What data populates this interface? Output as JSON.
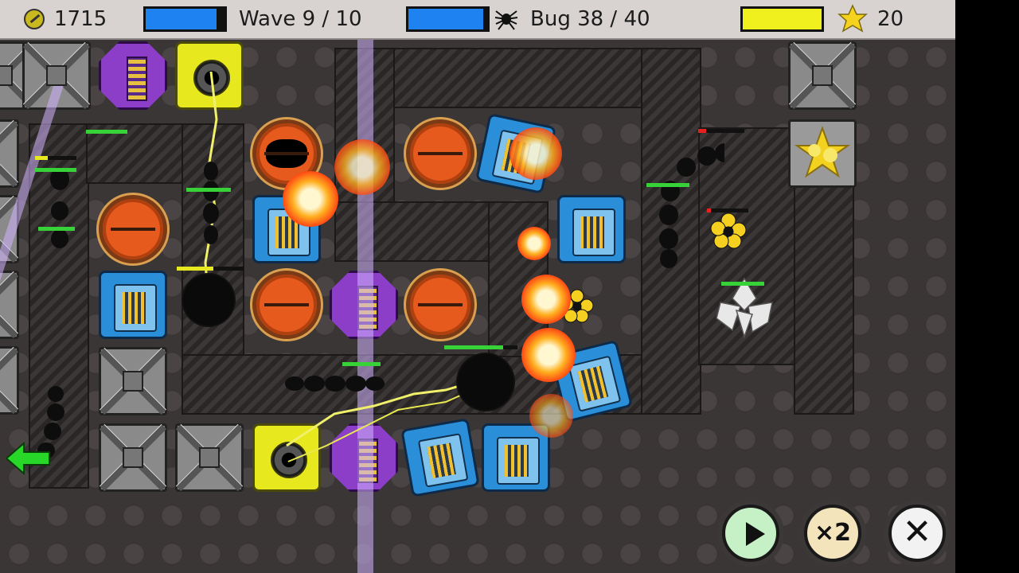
{
  "hud": {
    "coins": "1715",
    "wave_label": "Wave 9 / 10",
    "wave_progress": 0.9,
    "bug_label": "Bug 38 / 40",
    "bug_progress": 0.95,
    "star_progress": 1.0,
    "stars": "20",
    "icons": {
      "coins": "coin-icon",
      "bugs": "spider-icon",
      "stars": "star-icon"
    },
    "colors": {
      "wave_bar": "#1e82f0",
      "bug_bar": "#1e82f0",
      "star_bar": "#f0f01e"
    }
  },
  "controls": {
    "play_icon": "play-icon",
    "speed_label": "×2",
    "close_label": "✕"
  },
  "towers": {
    "types": [
      "orange-cannon",
      "blue-gatling",
      "purple-laser",
      "yellow-tesla",
      "empty-plate",
      "star-trophy"
    ]
  }
}
